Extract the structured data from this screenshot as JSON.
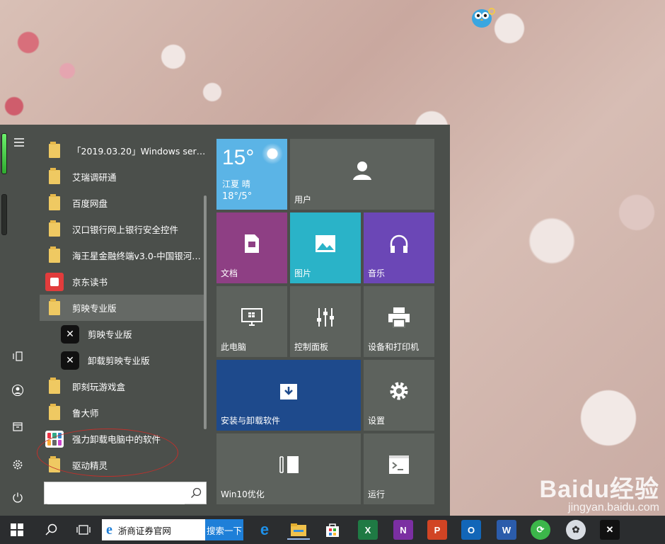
{
  "start_menu": {
    "apps": [
      {
        "label": "「2019.03.20」Windows serve...",
        "icon": "folder-icon"
      },
      {
        "label": "艾瑞调研通",
        "icon": "folder-icon"
      },
      {
        "label": "百度网盘",
        "icon": "folder-icon"
      },
      {
        "label": "汉口银行网上银行安全控件",
        "icon": "folder-icon"
      },
      {
        "label": "海王星金融终端v3.0-中国银河证...",
        "icon": "folder-icon"
      },
      {
        "label": "京东读书",
        "icon": "jd-read-icon"
      },
      {
        "label": "剪映专业版",
        "icon": "folder-icon",
        "expanded": true
      },
      {
        "label": "剪映专业版",
        "icon": "capcut-icon",
        "sub": true
      },
      {
        "label": "卸载剪映专业版",
        "icon": "capcut-icon",
        "sub": true
      },
      {
        "label": "即刻玩游戏盒",
        "icon": "folder-icon"
      },
      {
        "label": "鲁大师",
        "icon": "folder-icon"
      },
      {
        "label": "强力卸载电脑中的软件",
        "icon": "uninstaller-icon"
      },
      {
        "label": "驱动精灵",
        "icon": "folder-icon"
      }
    ],
    "search_placeholder": ""
  },
  "tiles": {
    "weather": {
      "temp": "15°",
      "city": "江夏 晴",
      "range": "18°/5°"
    },
    "user": "用户",
    "documents": "文档",
    "pictures": "图片",
    "music": "音乐",
    "this_pc": "此电脑",
    "control_panel": "控制面板",
    "devices_printers": "设备和打印机",
    "install_uninstall": "安装与卸载软件",
    "settings": "设置",
    "win10_optimize": "Win10优化",
    "run": "运行"
  },
  "taskbar": {
    "ie_text": "浙商证券官网",
    "search_button": "搜索一下"
  },
  "watermark": {
    "main": "Baidu经验",
    "sub": "jingyan.baidu.com"
  },
  "colors": {
    "start_bg": "#4b4f4b",
    "weather_tile": "#5bb4e6",
    "documents_tile": "#8e3f84",
    "pictures_tile": "#2ab3c8",
    "music_tile": "#6b47b6",
    "install_tile": "#1e4a8c",
    "taskbar_bg": "#2b2d2f",
    "accent_blue": "#1e7fd8",
    "annotation_red": "#c0302b"
  }
}
